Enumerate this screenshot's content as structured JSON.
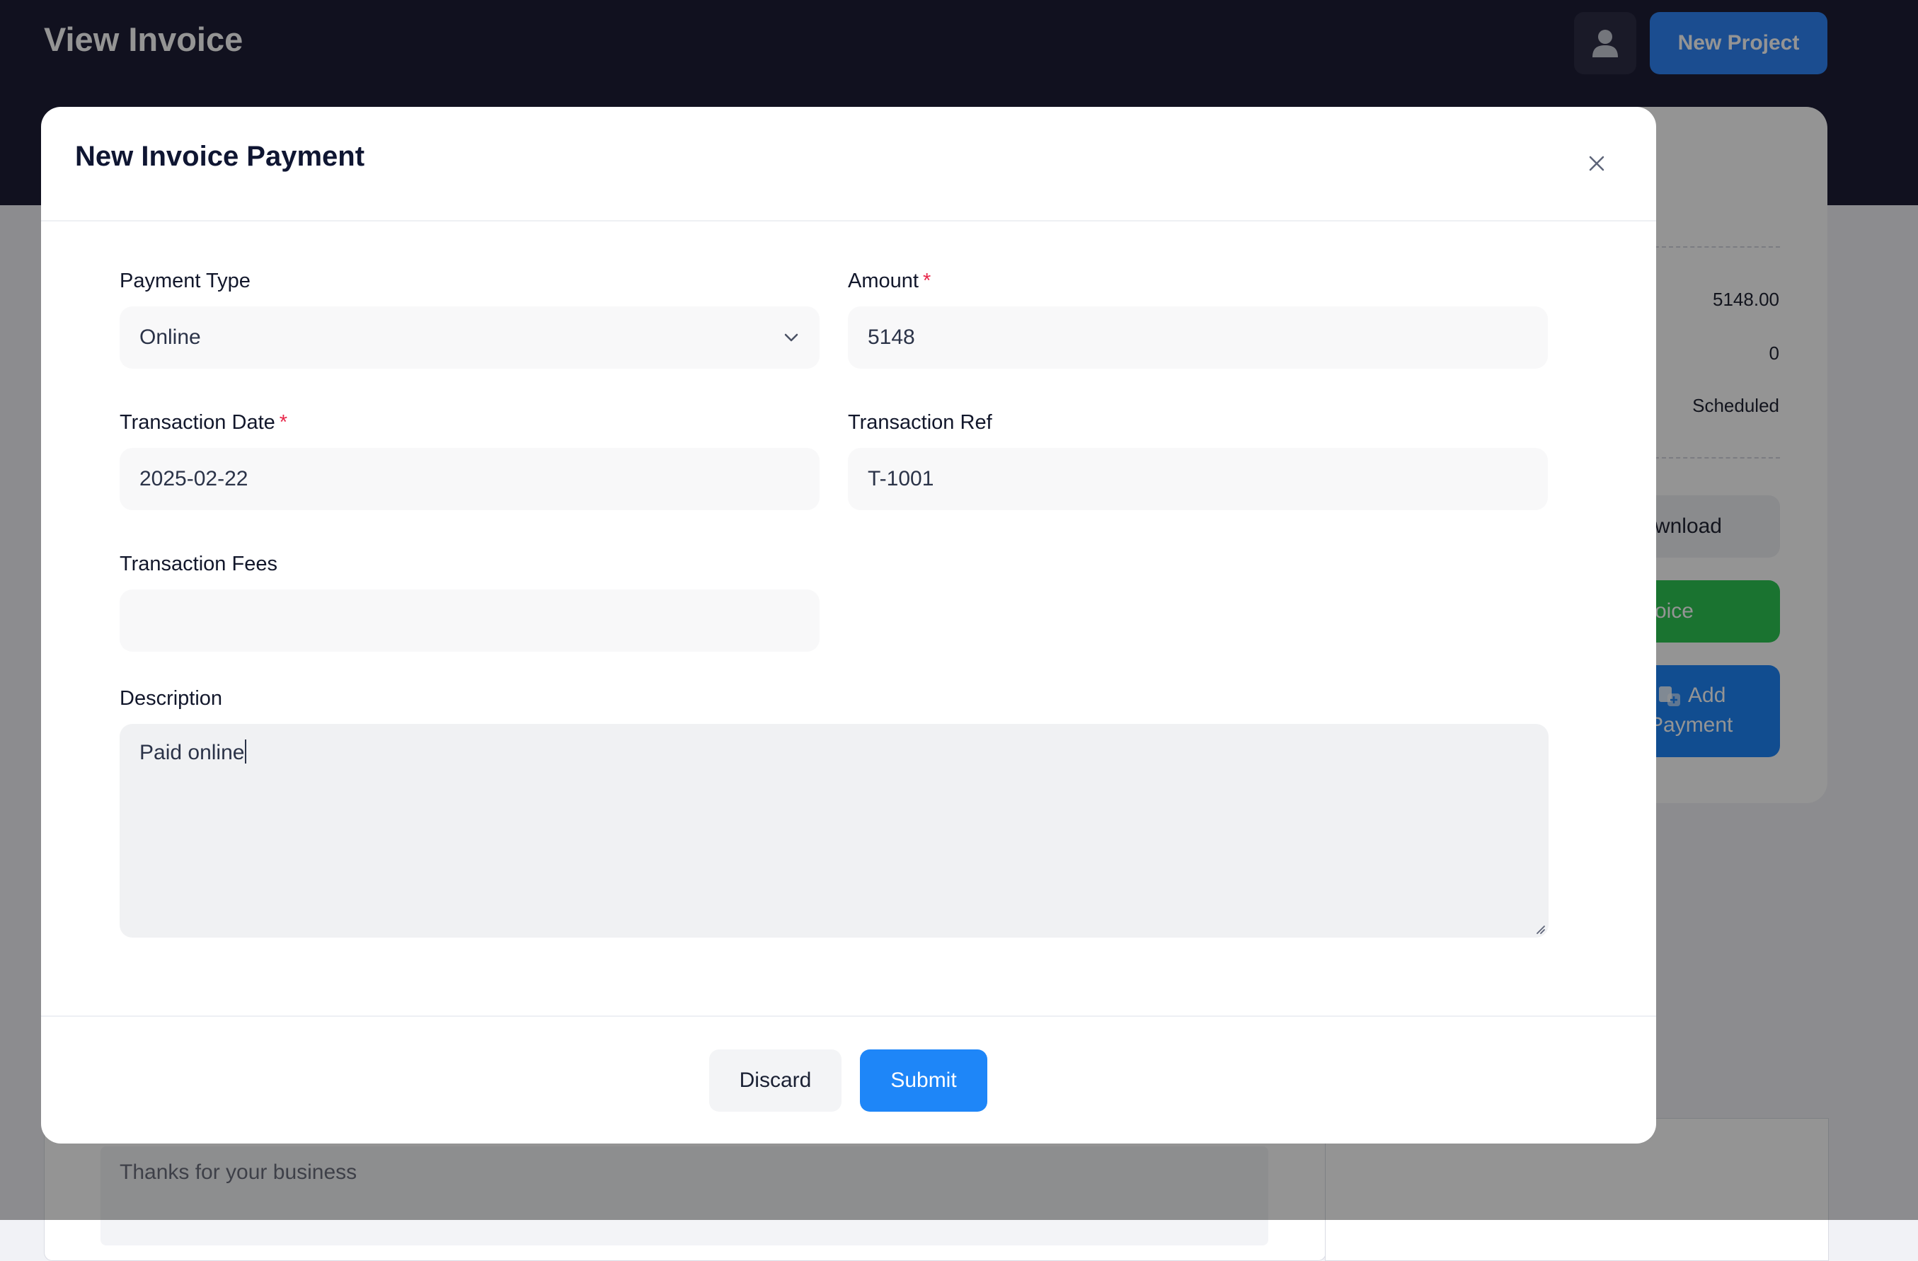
{
  "page": {
    "title": "View Invoice",
    "new_project_label": "New Project",
    "user_icon": "user-icon"
  },
  "summary": {
    "total": "5148.00",
    "paid": "0",
    "status": "Scheduled",
    "download_label": "Download",
    "invoice_label": "oice",
    "add_payment_label_1": "Add",
    "add_payment_label_2": "Payment"
  },
  "notes": {
    "text": "Thanks for your business"
  },
  "modal": {
    "title": "New Invoice Payment",
    "close_icon": "close-icon",
    "payment_type": {
      "label": "Payment Type",
      "value": "Online"
    },
    "amount": {
      "label": "Amount",
      "required": "*",
      "value": "5148"
    },
    "transaction_date": {
      "label": "Transaction Date",
      "required": "*",
      "value": "2025-02-22"
    },
    "transaction_ref": {
      "label": "Transaction Ref",
      "value": "T-1001"
    },
    "transaction_fees": {
      "label": "Transaction Fees",
      "value": ""
    },
    "description": {
      "label": "Description",
      "value": "Paid online"
    },
    "discard_label": "Discard",
    "submit_label": "Submit"
  },
  "colors": {
    "topbar": "#1e1e36",
    "primary": "#1e86f8",
    "success": "#2dc653",
    "required": "#e8274a"
  }
}
